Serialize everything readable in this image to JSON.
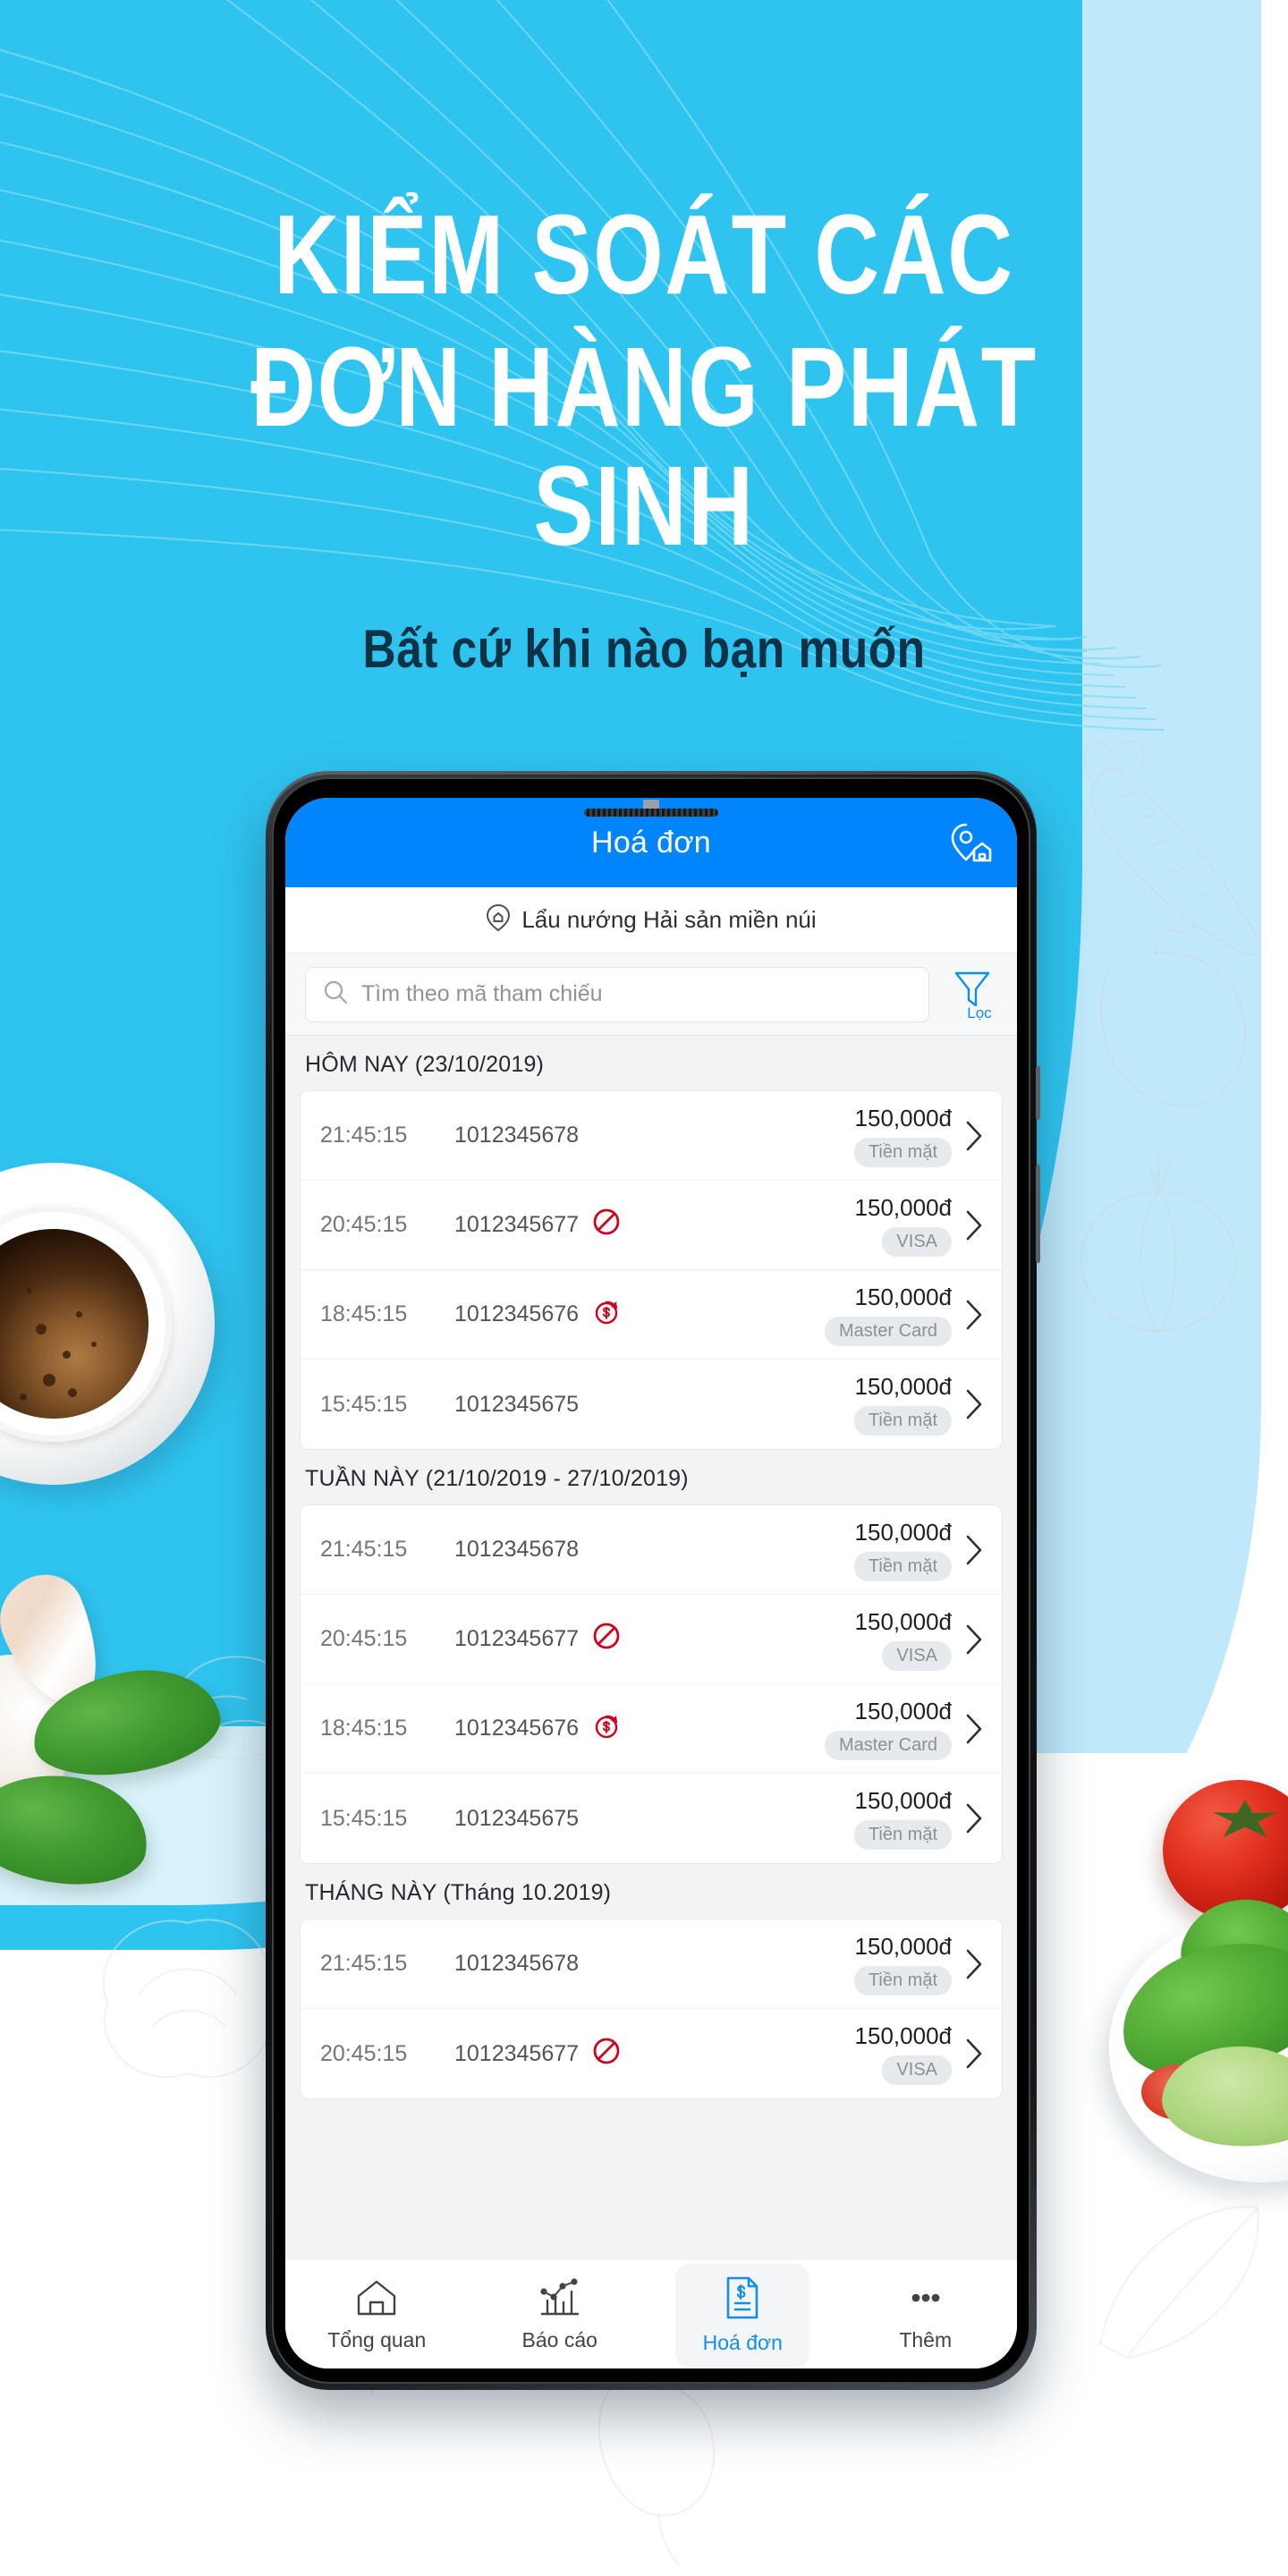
{
  "hero": {
    "line1": "KIỂM SOÁT CÁC",
    "line2": "ĐƠN HÀNG PHÁT SINH",
    "subtitle": "Bất cứ khi nào bạn muốn"
  },
  "colors": {
    "background_blue": "#2fc4f0",
    "background_blue_light": "#bfe9fa",
    "appbar_blue": "#0185fc",
    "accent_blue": "#0f8ef0",
    "subtitle_navy": "#0e3347",
    "danger_red": "#d0021b",
    "badge_grey": "#e7eaec"
  },
  "phone": {
    "appbar": {
      "title": "Hoá đơn",
      "action_icon": "location-store-icon"
    },
    "store": {
      "icon": "location-pin-icon",
      "name": "Lẩu nướng Hải sản miền núi"
    },
    "search": {
      "icon": "search-icon",
      "placeholder": "Tìm theo mã tham chiếu",
      "value": "",
      "filter_icon": "filter-funnel-icon",
      "filter_label": "Lọc"
    },
    "sections": [
      {
        "header": "HÔM NAY (23/10/2019)",
        "rows": [
          {
            "time": "21:45:15",
            "code": "1012345678",
            "status_icon": "",
            "amount": "150,000đ",
            "method": "Tiền mặt"
          },
          {
            "time": "20:45:15",
            "code": "1012345677",
            "status_icon": "cancelled-icon",
            "amount": "150,000đ",
            "method": "VISA"
          },
          {
            "time": "18:45:15",
            "code": "1012345676",
            "status_icon": "refunded-icon",
            "amount": "150,000đ",
            "method": "Master Card"
          },
          {
            "time": "15:45:15",
            "code": "1012345675",
            "status_icon": "",
            "amount": "150,000đ",
            "method": "Tiền mặt"
          }
        ]
      },
      {
        "header": "TUẦN NÀY (21/10/2019 - 27/10/2019)",
        "rows": [
          {
            "time": "21:45:15",
            "code": "1012345678",
            "status_icon": "",
            "amount": "150,000đ",
            "method": "Tiền mặt"
          },
          {
            "time": "20:45:15",
            "code": "1012345677",
            "status_icon": "cancelled-icon",
            "amount": "150,000đ",
            "method": "VISA"
          },
          {
            "time": "18:45:15",
            "code": "1012345676",
            "status_icon": "refunded-icon",
            "amount": "150,000đ",
            "method": "Master Card"
          },
          {
            "time": "15:45:15",
            "code": "1012345675",
            "status_icon": "",
            "amount": "150,000đ",
            "method": "Tiền mặt"
          }
        ]
      },
      {
        "header": "THÁNG NÀY (Tháng 10.2019)",
        "rows": [
          {
            "time": "21:45:15",
            "code": "1012345678",
            "status_icon": "",
            "amount": "150,000đ",
            "method": "Tiền mặt"
          },
          {
            "time": "20:45:15",
            "code": "1012345677",
            "status_icon": "cancelled-icon",
            "amount": "150,000đ",
            "method": "VISA"
          }
        ]
      }
    ],
    "bottom_nav": [
      {
        "label": "Tổng quan",
        "icon": "home-icon",
        "active": false
      },
      {
        "label": "Báo cáo",
        "icon": "chart-icon",
        "active": false
      },
      {
        "label": "Hoá đơn",
        "icon": "invoice-icon",
        "active": true
      },
      {
        "label": "Thêm",
        "icon": "more-dots-icon",
        "active": false
      }
    ]
  }
}
